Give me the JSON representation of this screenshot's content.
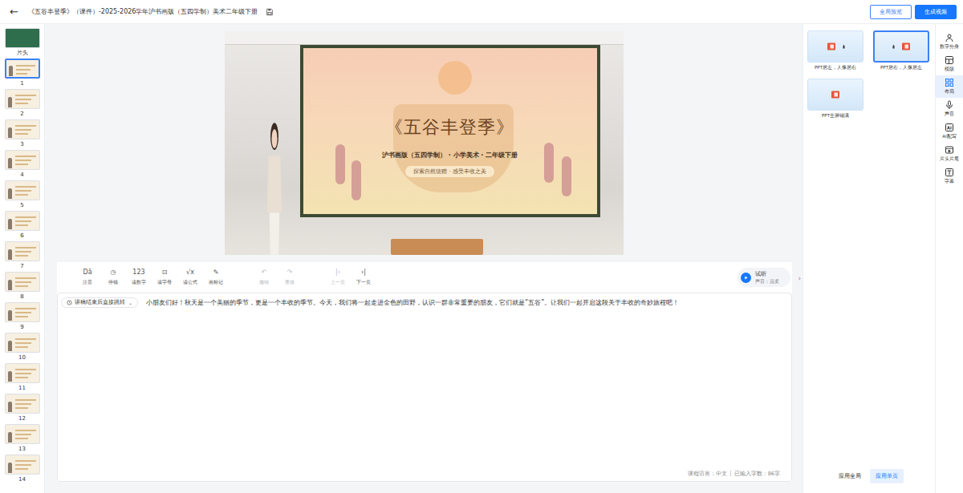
{
  "header": {
    "back": "←",
    "title": "《五谷丰登季》（课件）-2025-2026学年沪书画版（五四学制）美术二年级下册",
    "buttons": [
      {
        "label": "全局预览",
        "kind": "outline"
      },
      {
        "label": "生成视频",
        "kind": "primary"
      }
    ]
  },
  "slides": [
    {
      "label": "片头",
      "selected": false
    },
    {
      "label": "1",
      "selected": true
    },
    {
      "label": "2",
      "selected": false
    },
    {
      "label": "3",
      "selected": false
    },
    {
      "label": "4",
      "selected": false
    },
    {
      "label": "5",
      "selected": false
    },
    {
      "label": "6",
      "selected": false
    },
    {
      "label": "7",
      "selected": false
    },
    {
      "label": "8",
      "selected": false
    },
    {
      "label": "9",
      "selected": false
    },
    {
      "label": "10",
      "selected": false
    },
    {
      "label": "11",
      "selected": false
    },
    {
      "label": "12",
      "selected": false
    },
    {
      "label": "13",
      "selected": false
    },
    {
      "label": "14",
      "selected": false
    }
  ],
  "preview": {
    "slide_title": "《五谷丰登季》",
    "slide_subtitle": "沪书画版（五四学制） · 小学美术 · 二年级下册",
    "slide_tagline": "探索自然馈赠 · 感受丰收之美"
  },
  "toolbar": [
    {
      "icon": "Dā",
      "label": "注音",
      "disabled": false
    },
    {
      "icon": "◷",
      "label": "停顿",
      "disabled": false
    },
    {
      "icon": "123",
      "label": "读数字",
      "disabled": false
    },
    {
      "icon": "⊡",
      "label": "读字母",
      "disabled": false
    },
    {
      "icon": "√x",
      "label": "读公式",
      "disabled": false
    },
    {
      "icon": "✎",
      "label": "画标记",
      "disabled": false
    },
    {
      "icon": "↶",
      "label": "撤销",
      "disabled": true
    },
    {
      "icon": "↷",
      "label": "重做",
      "disabled": true
    },
    {
      "icon": "|‹",
      "label": "上一页",
      "disabled": true
    },
    {
      "icon": "›|",
      "label": "下一页",
      "disabled": false
    }
  ],
  "listen": {
    "label": "试听",
    "voice": "声音：温柔"
  },
  "script": {
    "jump": "讲稿结束后直接跳转",
    "jump_arrow": "⌄",
    "text": "小朋友们好！秋天是一个美丽的季节，更是一个丰收的季节。今天，我们将一起走进金色的田野，认识一群非常重要的朋友，它们就是“五谷”。让我们一起开启这段关于丰收的奇妙旅程吧！",
    "language": "课程语言：中文",
    "count": "已输入字数：86字"
  },
  "collapse": "›",
  "layouts": [
    {
      "label": "PPT居左，人像居右",
      "kind": "ppt-left",
      "selected": false
    },
    {
      "label": "PPT居右，人像居左",
      "kind": "ppt-right",
      "selected": true
    },
    {
      "label": "PPT全屏铺满",
      "kind": "ppt-full",
      "selected": false
    }
  ],
  "apply": [
    {
      "label": "应用全局",
      "selected": false
    },
    {
      "label": "应用单页",
      "selected": true
    }
  ],
  "nav": [
    {
      "label": "数字分身",
      "selected": false
    },
    {
      "label": "模版",
      "selected": false
    },
    {
      "label": "布局",
      "selected": true
    },
    {
      "label": "声音",
      "selected": false
    },
    {
      "label": "AI配写",
      "selected": false
    },
    {
      "label": "片头片尾",
      "selected": false
    },
    {
      "label": "字幕",
      "selected": false
    }
  ]
}
